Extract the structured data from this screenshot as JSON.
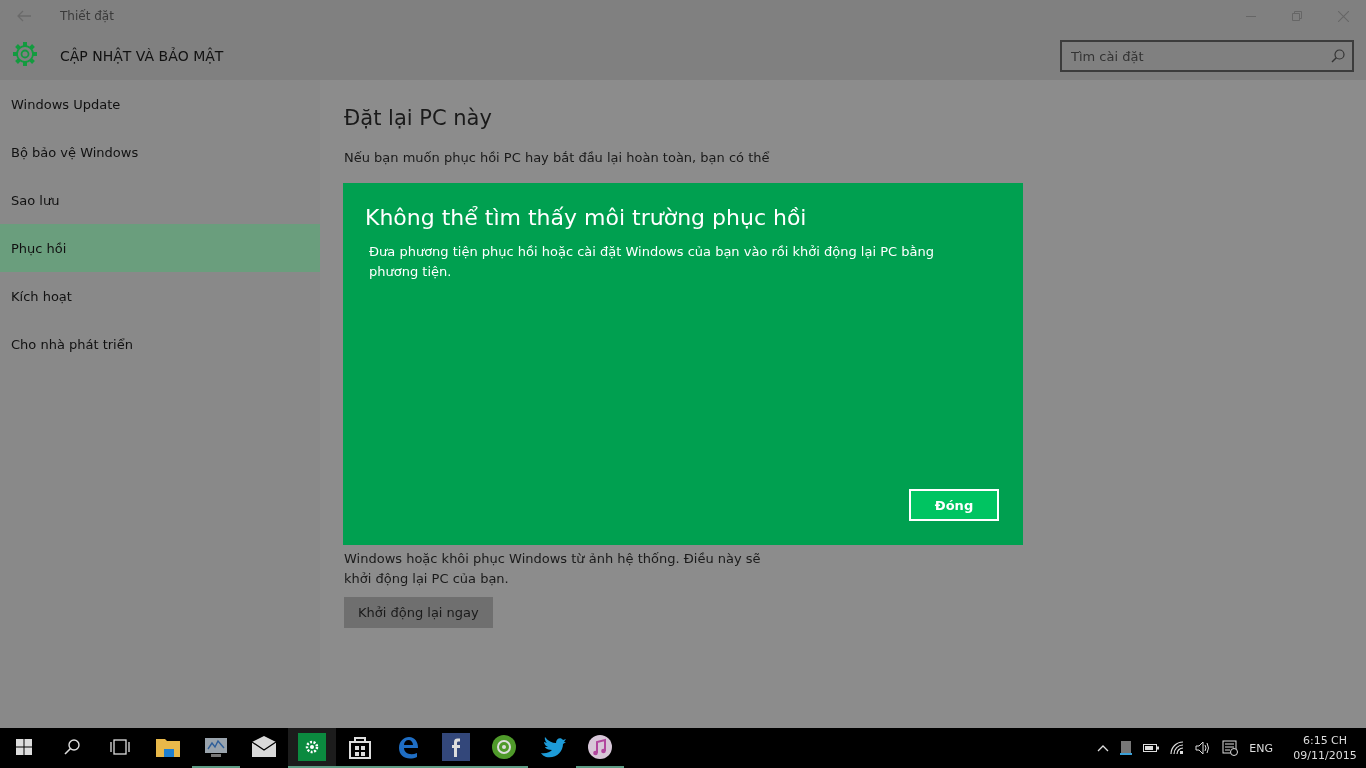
{
  "window": {
    "title": "Thiết đặt"
  },
  "header": {
    "title": "CẬP NHẬT VÀ BẢO MẬT",
    "search": {
      "placeholder": "Tìm cài đặt"
    }
  },
  "sidebar": {
    "items": [
      {
        "label": "Windows Update",
        "selected": false
      },
      {
        "label": "Bộ bảo vệ Windows",
        "selected": false
      },
      {
        "label": "Sao lưu",
        "selected": false
      },
      {
        "label": "Phục hồi",
        "selected": true
      },
      {
        "label": "Kích hoạt",
        "selected": false
      },
      {
        "label": "Cho nhà phát triển",
        "selected": false
      }
    ]
  },
  "content": {
    "heading": "Đặt lại PC này",
    "intro": "Nếu bạn muốn phục hồi PC hay bắt đầu lại hoàn toàn, bạn có thể",
    "lines": [
      "Windows hoặc khôi phục Windows từ ảnh hệ thống.  Điều này sẽ",
      "khởi động lại PC của bạn."
    ],
    "button": "Khởi động lại ngay"
  },
  "dialog": {
    "title": "Không thể tìm thấy môi trường phục hồi",
    "message": "Đưa phương  tiện phục hồi hoặc cài đặt Windows của bạn vào rồi khởi động lại PC bằng phương tiện.",
    "button": "Đóng"
  },
  "taskbar": {
    "apps": [
      {
        "kind": "folder",
        "running": false,
        "active": false
      },
      {
        "kind": "monitor",
        "running": true,
        "active": false
      },
      {
        "kind": "mail",
        "running": false,
        "active": false
      },
      {
        "kind": "settings",
        "running": true,
        "active": true
      },
      {
        "kind": "store",
        "running": true,
        "active": false
      },
      {
        "kind": "edge",
        "running": true,
        "active": false
      },
      {
        "kind": "facebook",
        "running": true,
        "active": false
      },
      {
        "kind": "disc",
        "running": true,
        "active": false
      },
      {
        "kind": "bird",
        "running": false,
        "active": false
      },
      {
        "kind": "music",
        "running": true,
        "active": false
      }
    ],
    "language": "ENG",
    "time": "6:15 CH",
    "date": "09/11/2015"
  }
}
